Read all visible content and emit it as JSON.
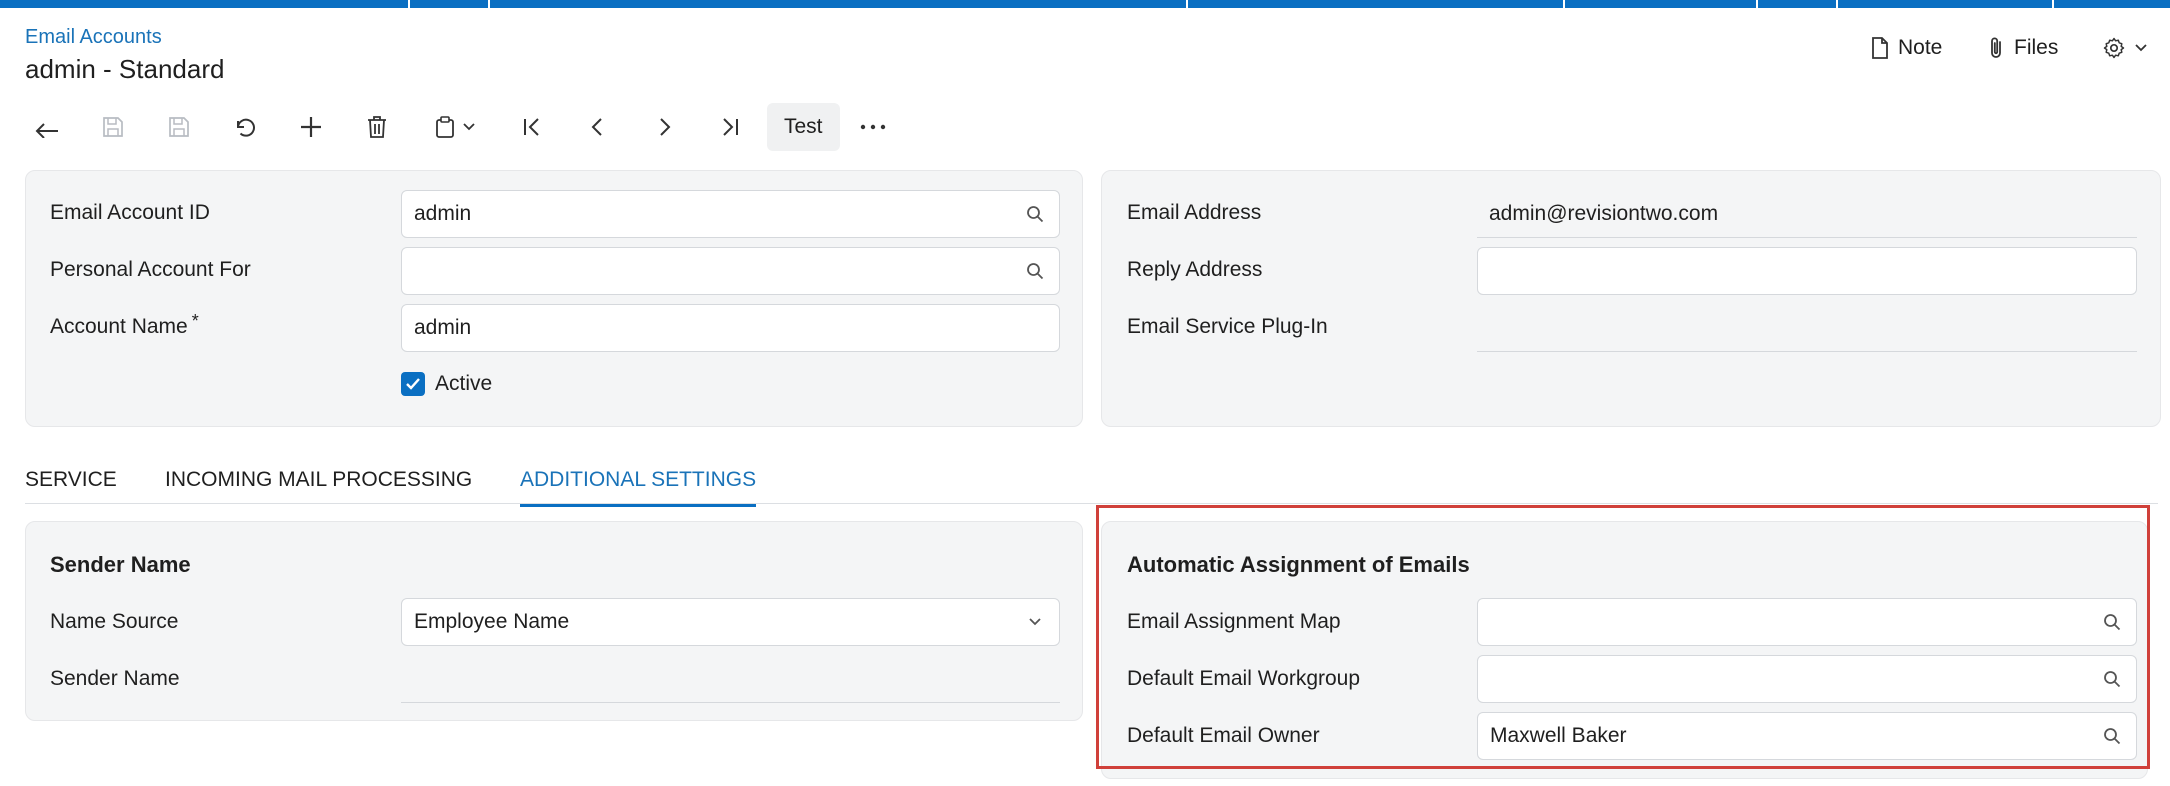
{
  "breadcrumb": "Email Accounts",
  "title": "admin - Standard",
  "header_actions": {
    "note": "Note",
    "files": "Files",
    "settings_icon": "gear-icon"
  },
  "toolbar": {
    "icons": [
      "back-icon",
      "save-close-icon",
      "save-icon",
      "undo-icon",
      "add-icon",
      "delete-icon",
      "clipboard-icon",
      "first-icon",
      "previous-icon",
      "next-icon",
      "last-icon",
      "more-icon"
    ],
    "test_label": "Test"
  },
  "form_left": {
    "email_account_id": {
      "label": "Email Account ID",
      "value": "admin"
    },
    "personal_account_for": {
      "label": "Personal Account For",
      "value": ""
    },
    "account_name": {
      "label": "Account Name",
      "required_mark": "*",
      "value": "admin"
    },
    "active": {
      "label": "Active",
      "checked": true
    }
  },
  "form_right": {
    "email_address": {
      "label": "Email Address",
      "value": "admin@revisiontwo.com"
    },
    "reply_address": {
      "label": "Reply Address",
      "value": ""
    },
    "email_service_plugin": {
      "label": "Email Service Plug-In",
      "value": ""
    }
  },
  "tabs": [
    {
      "label": "SERVICE",
      "active": false
    },
    {
      "label": "INCOMING MAIL PROCESSING",
      "active": false
    },
    {
      "label": "ADDITIONAL SETTINGS",
      "active": true
    }
  ],
  "sender_section": {
    "title": "Sender Name",
    "name_source": {
      "label": "Name Source",
      "value": "Employee Name"
    },
    "sender_name": {
      "label": "Sender Name",
      "value": ""
    }
  },
  "assignment_section": {
    "title": "Automatic Assignment of Emails",
    "assignment_map": {
      "label": "Email Assignment Map",
      "value": ""
    },
    "default_workgroup": {
      "label": "Default Email Workgroup",
      "value": ""
    },
    "default_owner": {
      "label": "Default Email Owner",
      "value": "Maxwell Baker"
    }
  },
  "colors": {
    "accent": "#0a6fc2",
    "link": "#1a73b8",
    "highlight": "#d0403a",
    "card": "#f4f5f6"
  }
}
